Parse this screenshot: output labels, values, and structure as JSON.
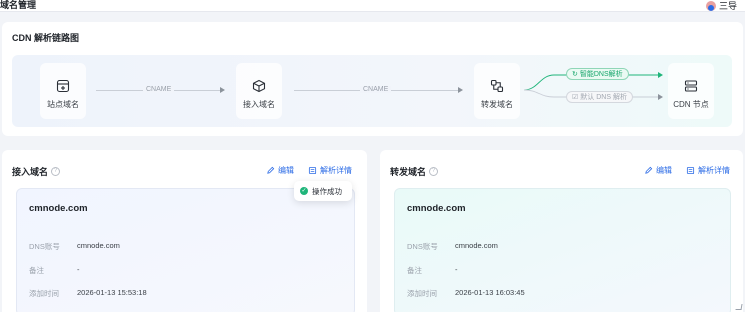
{
  "header": {
    "title": "域名管理",
    "user_name": "三导"
  },
  "flow": {
    "title": "CDN 解析链路图",
    "nodes": {
      "site": "站点域名",
      "access": "接入域名",
      "forward": "转发域名",
      "cdn": "CDN 节点"
    },
    "edges": {
      "cname1": "CNAME",
      "cname2": "CNAME"
    },
    "branches": {
      "smart": "智能DNS解析",
      "normal": "默认 DNS 解析"
    }
  },
  "access_card": {
    "title": "接入域名",
    "edit_label": "编辑",
    "detail_label": "解析详情",
    "domain": "cmnode.com",
    "dns_label": "DNS账号",
    "dns_value": "cmnode.com",
    "note_label": "备注",
    "note_value": "-",
    "time_label": "添加时间",
    "time_value": "2026-01-13 15:53:18"
  },
  "forward_card": {
    "title": "转发域名",
    "edit_label": "编辑",
    "detail_label": "解析详情",
    "domain": "cmnode.com",
    "dns_label": "DNS账号",
    "dns_value": "cmnode.com",
    "note_label": "备注",
    "note_value": "-",
    "time_label": "添加时间",
    "time_value": "2026-01-13 16:03:45"
  },
  "toast": {
    "message": "操作成功"
  },
  "colors": {
    "accent": "#2b6be6",
    "success": "#1fb57a"
  }
}
